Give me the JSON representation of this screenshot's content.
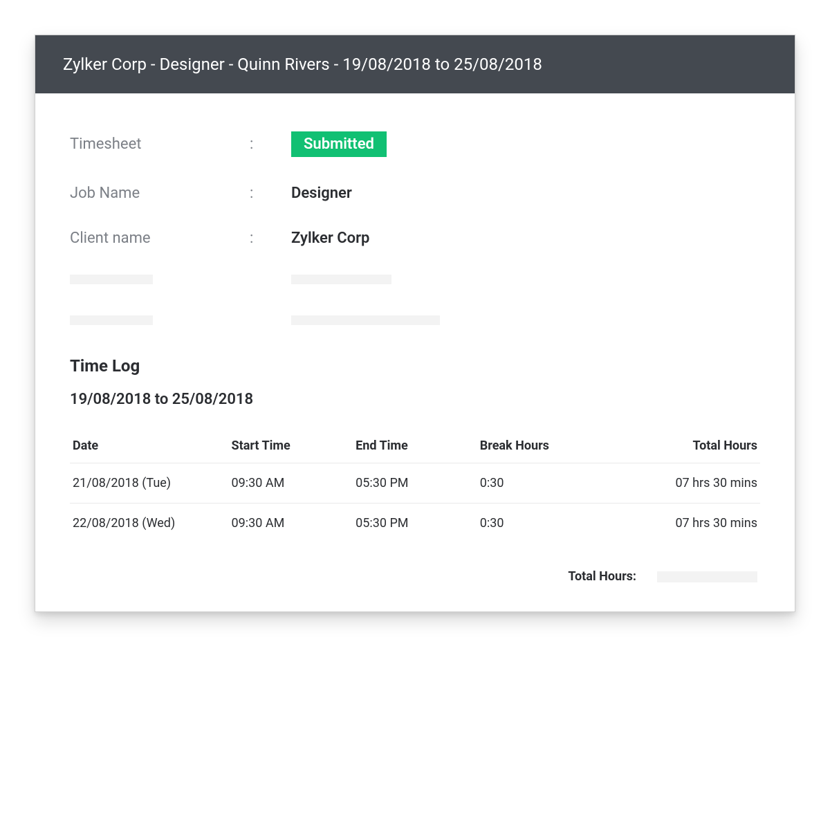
{
  "header": {
    "title": "Zylker Corp - Designer - Quinn Rivers - 19/08/2018 to 25/08/2018"
  },
  "info": {
    "timesheet_label": "Timesheet",
    "timesheet_status": "Submitted",
    "job_label": "Job Name",
    "job_value": "Designer",
    "client_label": "Client name",
    "client_value": "Zylker Corp",
    "colon": ":"
  },
  "timelog": {
    "title": "Time Log",
    "range": "19/08/2018 to 25/08/2018",
    "columns": {
      "date": "Date",
      "start": "Start Time",
      "end": "End Time",
      "break": "Break Hours",
      "total": "Total Hours"
    },
    "rows": [
      {
        "date": "21/08/2018 (Tue)",
        "start": "09:30 AM",
        "end": "05:30 PM",
        "break": "0:30",
        "total": "07 hrs 30 mins"
      },
      {
        "date": "22/08/2018 (Wed)",
        "start": "09:30 AM",
        "end": "05:30 PM",
        "break": "0:30",
        "total": "07 hrs 30 mins"
      }
    ],
    "footer_label": "Total Hours:"
  }
}
